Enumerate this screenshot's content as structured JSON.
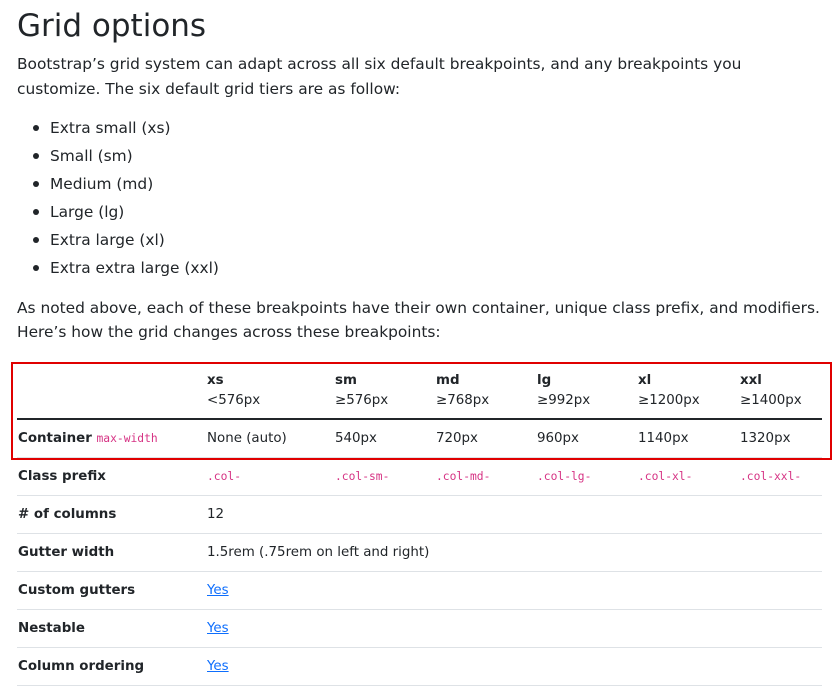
{
  "title": "Grid options",
  "intro": "Bootstrap’s grid system can adapt across all six default breakpoints, and any breakpoints you customize. The six default grid tiers are as follow:",
  "tiers": [
    "Extra small (xs)",
    "Small (sm)",
    "Medium (md)",
    "Large (lg)",
    "Extra large (xl)",
    "Extra extra large (xxl)"
  ],
  "note": "As noted above, each of these breakpoints have their own container, unique class prefix, and modifiers. Here’s how the grid changes across these breakpoints:",
  "table": {
    "headers": [
      {
        "name": "xs",
        "size": "<576px"
      },
      {
        "name": "sm",
        "size": "≥576px"
      },
      {
        "name": "md",
        "size": "≥768px"
      },
      {
        "name": "lg",
        "size": "≥992px"
      },
      {
        "name": "xl",
        "size": "≥1200px"
      },
      {
        "name": "xxl",
        "size": "≥1400px"
      }
    ],
    "container": {
      "label": "Container",
      "code": "max-width",
      "values": [
        "None (auto)",
        "540px",
        "720px",
        "960px",
        "1140px",
        "1320px"
      ]
    },
    "class_prefix": {
      "label": "Class prefix",
      "values": [
        ".col-",
        ".col-sm-",
        ".col-md-",
        ".col-lg-",
        ".col-xl-",
        ".col-xxl-"
      ]
    },
    "columns": {
      "label": "# of columns",
      "value": "12"
    },
    "gutter": {
      "label": "Gutter width",
      "value": "1.5rem (.75rem on left and right)"
    },
    "custom_gutters": {
      "label": "Custom gutters",
      "value": "Yes"
    },
    "nestable": {
      "label": "Nestable",
      "value": "Yes"
    },
    "ordering": {
      "label": "Column ordering",
      "value": "Yes"
    }
  },
  "colors": {
    "text": "#212529",
    "code": "#d63384",
    "link": "#0d6efd",
    "highlight": "#e00000"
  }
}
